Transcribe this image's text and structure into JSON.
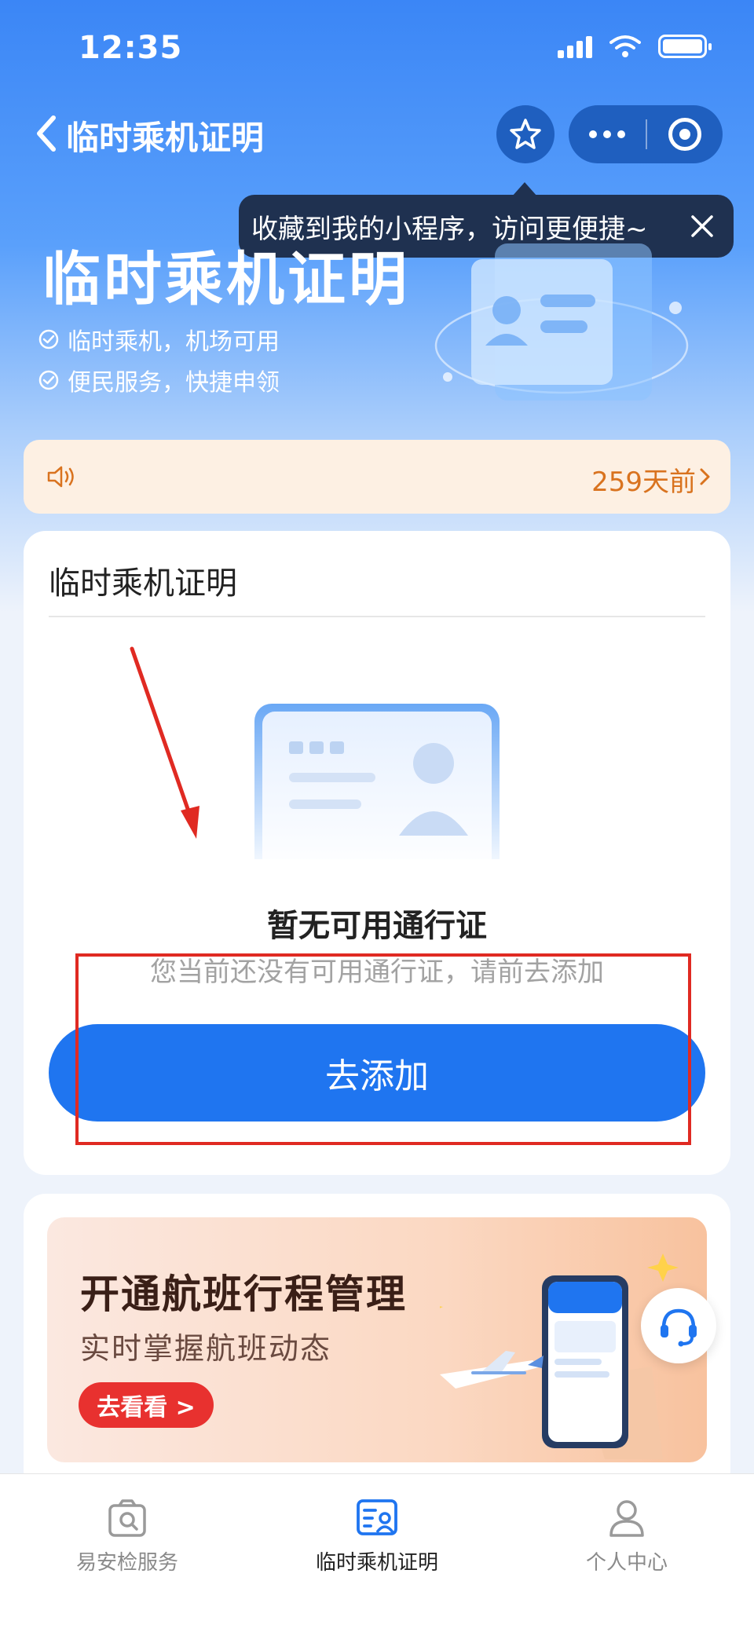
{
  "status_bar": {
    "time": "12:35"
  },
  "nav": {
    "title": "临时乘机证明"
  },
  "tooltip": {
    "text": "收藏到我的小程序，访问更便捷~"
  },
  "hero": {
    "title": "临时乘机证明",
    "features": [
      "临时乘机，机场可用",
      "便民服务，快捷申领"
    ]
  },
  "notice": {
    "time_ago": "259天前"
  },
  "card": {
    "title": "临时乘机证明",
    "empty_title": "暂无可用通行证",
    "empty_desc": "您当前还没有可用通行证，请前去添加",
    "add_button": "去添加"
  },
  "promo": {
    "title": "开通航班行程管理",
    "subtitle": "实时掌握航班动态",
    "button": "去看看"
  },
  "tabs": [
    {
      "label": "易安检服务",
      "icon": "security-check-icon",
      "active": false
    },
    {
      "label": "临时乘机证明",
      "icon": "id-card-icon",
      "active": true
    },
    {
      "label": "个人中心",
      "icon": "user-icon",
      "active": false
    }
  ],
  "colors": {
    "primary": "#1f75f0",
    "annotation": "#e02a22",
    "notice_text": "#d9731f",
    "promo_button": "#e8312f"
  }
}
